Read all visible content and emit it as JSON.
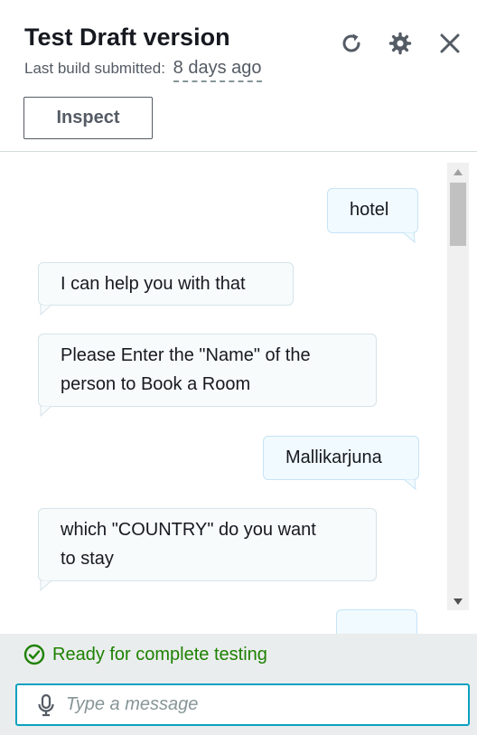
{
  "header": {
    "title": "Test Draft version",
    "subtitle_label": "Last build submitted:",
    "subtitle_value": "8 days ago",
    "inspect_label": "Inspect",
    "icons": [
      "refresh-icon",
      "gear-icon",
      "close-icon"
    ]
  },
  "chat": {
    "messages": [
      {
        "role": "user",
        "text": "hotel"
      },
      {
        "role": "bot",
        "text": "I can help you with that"
      },
      {
        "role": "bot",
        "lines": [
          "Please Enter the \"Name\" of the",
          "person to Book a Room"
        ]
      },
      {
        "role": "user",
        "text": "Mallikarjuna"
      },
      {
        "role": "bot",
        "lines": [
          "which \"COUNTRY\" do you want",
          "to stay"
        ]
      }
    ]
  },
  "footer": {
    "status": "Ready for complete testing",
    "status_color": "#1d8102",
    "input_placeholder": "Type a message",
    "input_border_color": "#0aa1c0"
  }
}
